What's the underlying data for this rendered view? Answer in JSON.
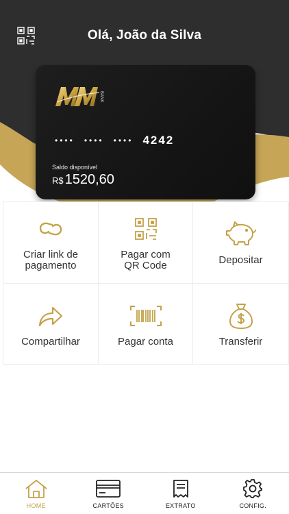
{
  "header": {
    "greeting": "Olá, João da Silva"
  },
  "card": {
    "brand": "MM BANK",
    "number_mask": [
      "••••",
      "••••",
      "••••"
    ],
    "last4": "4242",
    "balance_label": "Saldo disponível",
    "currency": "R$",
    "balance": "1520,60"
  },
  "actions": [
    {
      "label": "Criar link de\npagamento",
      "icon": "link-icon"
    },
    {
      "label": "Pagar com\nQR Code",
      "icon": "qr-code-icon"
    },
    {
      "label": "Depositar",
      "icon": "piggy-bank-icon"
    },
    {
      "label": "Compartilhar",
      "icon": "share-arrow-icon"
    },
    {
      "label": "Pagar conta",
      "icon": "barcode-icon"
    },
    {
      "label": "Transferir",
      "icon": "money-bag-icon"
    }
  ],
  "nav": [
    {
      "label": "HOME",
      "icon": "home-icon",
      "active": true
    },
    {
      "label": "CARTÕES",
      "icon": "card-icon",
      "active": false
    },
    {
      "label": "EXTRATO",
      "icon": "receipt-icon",
      "active": false
    },
    {
      "label": "CONFIG.",
      "icon": "gear-icon",
      "active": false
    }
  ],
  "colors": {
    "gold": "#c4a24a",
    "dark": "#2b2b2b",
    "card": "#161616"
  }
}
